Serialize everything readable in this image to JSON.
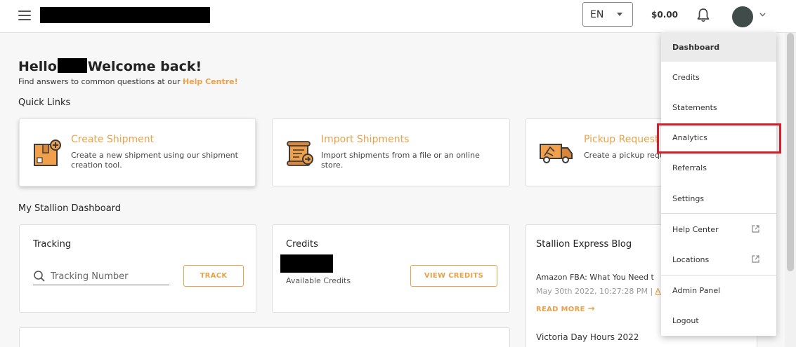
{
  "header": {
    "language": "EN",
    "balance": "$0.00"
  },
  "greeting": {
    "hello": "Hello",
    "welcome": "Welcome back!",
    "help_text": "Find answers to common questions at our",
    "help_link": "Help Centre!"
  },
  "quick_links": {
    "title": "Quick Links",
    "items": [
      {
        "title": "Create Shipment",
        "desc": "Create a new shipment using our shipment creation tool.",
        "icon": "package-plus-icon"
      },
      {
        "title": "Import Shipments",
        "desc": "Import shipments from a file or an online store.",
        "icon": "scroll-import-icon"
      },
      {
        "title": "Pickup Request",
        "desc": "Create a pickup request for your shipments.",
        "icon": "delivery-truck-icon"
      }
    ]
  },
  "dashboard": {
    "title": "My Stallion Dashboard",
    "tracking": {
      "title": "Tracking",
      "placeholder": "Tracking Number",
      "button": "TRACK"
    },
    "credits": {
      "title": "Credits",
      "subtitle": "Available Credits",
      "button": "VIEW CREDITS"
    },
    "blog": {
      "title": "Stallion Express Blog",
      "posts": [
        {
          "title": "Amazon FBA: What You Need t",
          "date": "May 30th 2022, 10:27:28 PM | ",
          "more": "Ar",
          "read_more": "READ MORE"
        },
        {
          "title": "Victoria Day Hours 2022"
        }
      ]
    }
  },
  "user_menu": {
    "items": [
      {
        "label": "Dashboard"
      },
      {
        "label": "Credits"
      },
      {
        "label": "Statements"
      },
      {
        "label": "Analytics"
      },
      {
        "label": "Referrals"
      },
      {
        "label": "Settings"
      },
      {
        "label": "Help Center"
      },
      {
        "label": "Locations"
      },
      {
        "label": "Admin Panel"
      },
      {
        "label": "Logout"
      }
    ]
  },
  "colors": {
    "accent": "#e9a14a",
    "highlight": "#d21f2b"
  }
}
